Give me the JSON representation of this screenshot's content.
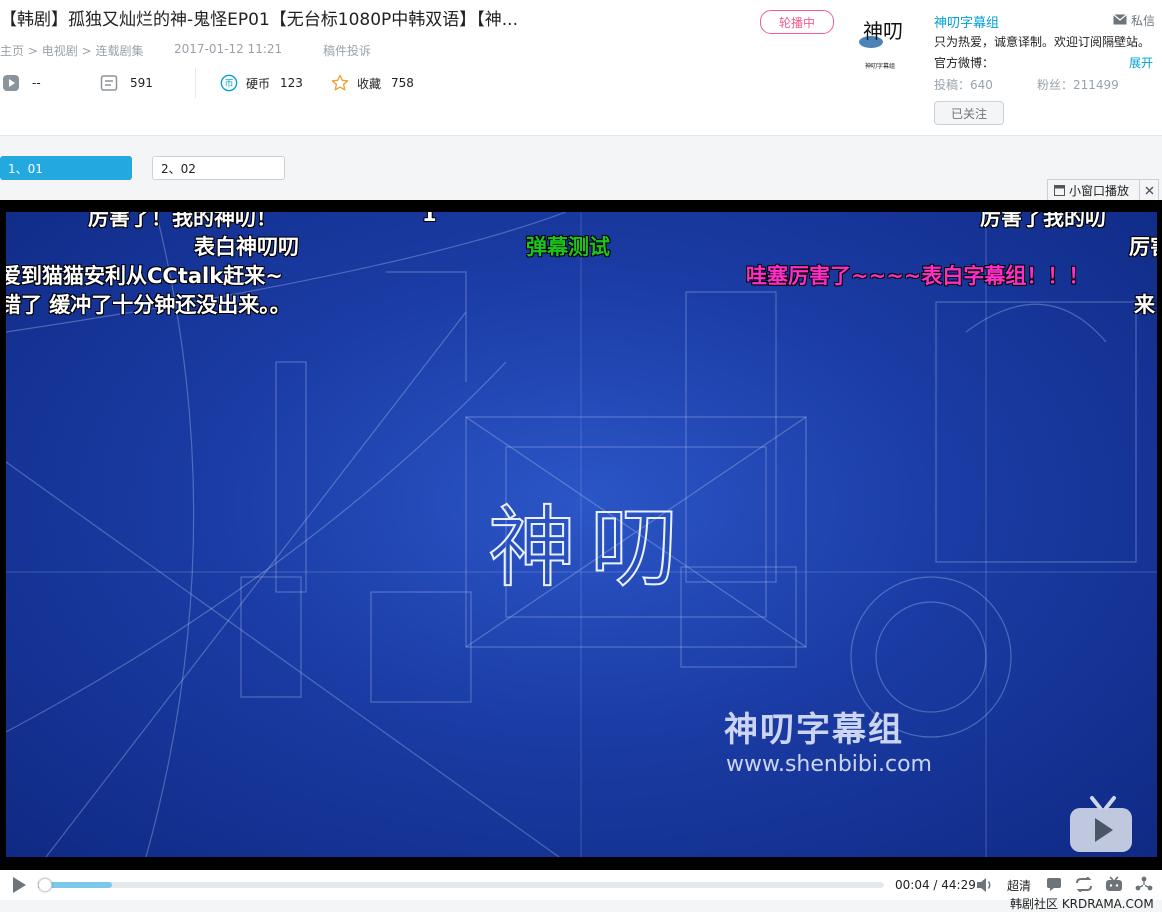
{
  "video": {
    "title": "【韩剧】孤独又灿烂的神-鬼怪EP01【无台标1080P中韩双语】【神...",
    "breadcrumb": [
      "主页",
      "电视剧",
      "连载剧集"
    ],
    "breadcrumb_sep": ">",
    "date": "2017-01-12 11:21",
    "report": "稿件投诉",
    "stats": {
      "play_value": "--",
      "danmaku_value": "591",
      "coin_label": "硬币",
      "coin_value": "123",
      "fav_label": "收藏",
      "fav_value": "758"
    },
    "carousel_badge": "轮播中"
  },
  "uploader": {
    "name": "神叨字幕组",
    "message_label": "私信",
    "description": "只为热爱，诚意译制。欢迎订阅隔壁站。",
    "weibo_label": "官方微博：",
    "expand_label": "展开",
    "posts_label": "投稿：640",
    "fans_label": "粉丝：211499",
    "follow_label": "已关注",
    "avatar_text": "神叨",
    "avatar_sub": "神叨字幕组"
  },
  "episodes": [
    {
      "label": "1、01",
      "active": true
    },
    {
      "label": "2、02",
      "active": false
    }
  ],
  "mini_window_label": "小窗口播放",
  "danmaku": [
    {
      "text": "厉害了！我的神叨！",
      "color": "#ffffff"
    },
    {
      "text": "1",
      "color": "#ffffff"
    },
    {
      "text": "厉害了我的叨",
      "color": "#ffffff"
    },
    {
      "text": "表白神叨叨",
      "color": "#ffffff"
    },
    {
      "text": "弹幕测试",
      "color": "#1ec31e"
    },
    {
      "text": "厉害",
      "color": "#ffffff"
    },
    {
      "text": "爱到猫猫安利从CCtalk赶来~",
      "color": "#ffffff"
    },
    {
      "text": "哇塞厉害了~~~~表白字幕组！！！",
      "color": "#ff2ec8"
    },
    {
      "text": "错了 缓冲了十分钟还没出来。。",
      "color": "#ffffff"
    },
    {
      "text": "来",
      "color": "#ffffff"
    }
  ],
  "screen": {
    "logo": "神叨",
    "watermark_name": "神叨字幕组",
    "watermark_url": "www.shenbibi.com"
  },
  "player": {
    "current_time": "00:04",
    "total_time": "44:29",
    "time_sep": " / ",
    "quality": "超清",
    "progress": 0.0015,
    "buffered": 0.088
  },
  "footer": {
    "site_label": "韩剧社区 KRDRAMA.COM"
  }
}
